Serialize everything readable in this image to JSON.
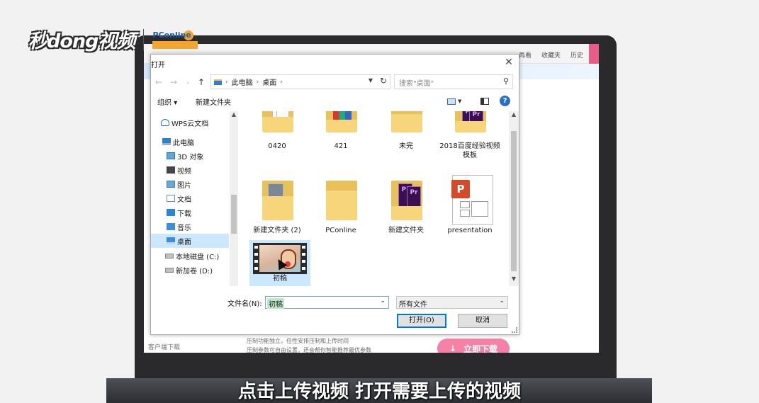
{
  "watermark": {
    "logo_text": "秒dong视频",
    "partner_text": "PConline"
  },
  "browser_bg": {
    "nav": [
      "再看",
      "收藏夹",
      "历史"
    ],
    "client_download": "客户端下载",
    "feature_lines": [
      "压制功能独立，任性安排压制和上传时间",
      "压制参数可自由设置，还会帮你智能推荐最优参数"
    ],
    "download_button": "立即下载"
  },
  "dialog": {
    "title": "打开",
    "address": {
      "root": "此电脑",
      "folder": "桌面"
    },
    "search_placeholder": "搜索\"桌面\"",
    "toolbar": {
      "organize": "组织 ▾",
      "new_folder": "新建文件夹",
      "help": "?"
    },
    "nav_items": [
      "WPS云文档",
      "此电脑",
      "3D 对象",
      "视频",
      "图片",
      "文档",
      "下载",
      "音乐",
      "桌面",
      "本地磁盘 (C:)",
      "新加卷 (D:)"
    ],
    "selected_nav": "桌面",
    "files": [
      {
        "name": "0420",
        "type": "folder-papers"
      },
      {
        "name": "421",
        "type": "archive"
      },
      {
        "name": "未完",
        "type": "folder"
      },
      {
        "name": "2018百度经验视频模板",
        "type": "folder-premiere"
      },
      {
        "name": "新建文件夹 (2)",
        "type": "folder-photo"
      },
      {
        "name": "PConline",
        "type": "folder"
      },
      {
        "name": "新建文件夹",
        "type": "folder-premiere"
      },
      {
        "name": "presentation",
        "type": "ppt"
      },
      {
        "name": "初稿",
        "type": "video",
        "selected": true
      }
    ],
    "filename_label": "文件名(N):",
    "filename_value": "初稿",
    "filetype_value": "所有文件",
    "open_button": "打开(O)",
    "cancel_button": "取消"
  },
  "subtitle": "点击上传视频 打开需要上传的视频"
}
